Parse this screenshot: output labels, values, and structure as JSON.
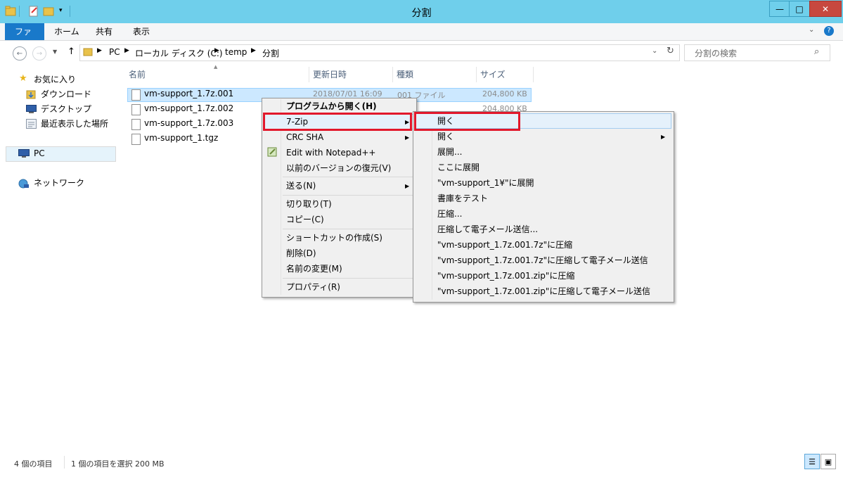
{
  "window": {
    "title": "分割"
  },
  "ribbon": {
    "tabs": [
      "ファイル",
      "ホーム",
      "共有",
      "表示"
    ]
  },
  "address": {
    "crumbs": [
      "PC",
      "ローカル ディスク (C:)",
      "temp",
      "分割"
    ],
    "search_placeholder": "分割の検索"
  },
  "nav_pane": {
    "favorites_label": "お気に入り",
    "favorites": [
      "ダウンロード",
      "デスクトップ",
      "最近表示した場所"
    ],
    "pc_label": "PC",
    "network_label": "ネットワーク"
  },
  "columns": [
    "名前",
    "更新日時",
    "種類",
    "サイズ"
  ],
  "files": [
    {
      "name": "vm-support_1.7z.001",
      "date": "2018/07/01 16:09",
      "type": "001 ファイル",
      "size": "204,800 KB"
    },
    {
      "name": "vm-support_1.7z.002",
      "date": "",
      "type": "",
      "size": "204,800 KB"
    },
    {
      "name": "vm-support_1.7z.003",
      "date": "",
      "type": "",
      "size": ""
    },
    {
      "name": "vm-support_1.tgz",
      "date": "",
      "type": "",
      "size": ""
    }
  ],
  "context_menu": {
    "items": [
      "プログラムから開く(H)",
      "7-Zip",
      "CRC SHA",
      "Edit with Notepad++",
      "以前のバージョンの復元(V)",
      "送る(N)",
      "切り取り(T)",
      "コピー(C)",
      "ショートカットの作成(S)",
      "削除(D)",
      "名前の変更(M)",
      "プロパティ(R)"
    ]
  },
  "submenu_7zip": {
    "items": [
      "開く",
      "開く",
      "展開...",
      "ここに展開",
      "\"vm-support_1¥\"に展開",
      "書庫をテスト",
      "圧縮...",
      "圧縮して電子メール送信...",
      "\"vm-support_1.7z.001.7z\"に圧縮",
      "\"vm-support_1.7z.001.7z\"に圧縮して電子メール送信",
      "\"vm-support_1.7z.001.zip\"に圧縮",
      "\"vm-support_1.7z.001.zip\"に圧縮して電子メール送信"
    ]
  },
  "status": {
    "item_count": "4 個の項目",
    "selection": "1 個の項目を選択  200 MB"
  },
  "colors": {
    "titlebar": "#6fcfeb",
    "file_tab": "#1979ca",
    "selection": "#cce8ff",
    "highlight_box": "#e2182b"
  }
}
